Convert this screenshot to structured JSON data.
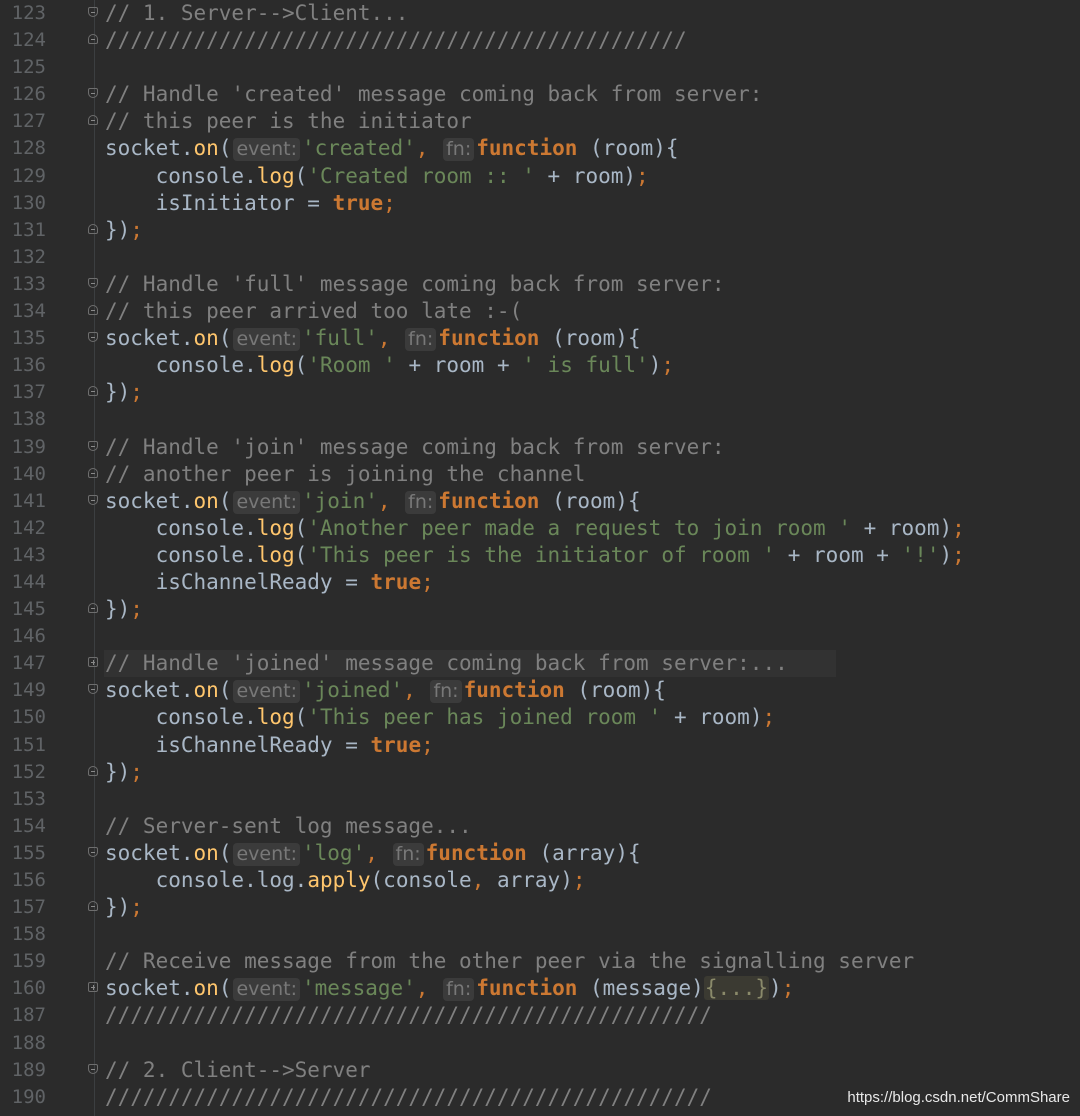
{
  "editor": {
    "lines": [
      {
        "num": "123",
        "fold": "start",
        "segs": [
          {
            "t": "// 1. Server-->Client...",
            "c": "cm"
          }
        ]
      },
      {
        "num": "124",
        "fold": "end",
        "segs": [
          {
            "t": "//////////////////////////////////////////////",
            "c": "cm"
          }
        ]
      },
      {
        "num": "125",
        "fold": "",
        "segs": []
      },
      {
        "num": "126",
        "fold": "start",
        "segs": [
          {
            "t": "// Handle 'created' message coming back from server:",
            "c": "cm"
          }
        ]
      },
      {
        "num": "127",
        "fold": "end",
        "segs": [
          {
            "t": "// this peer is the initiator",
            "c": "cm"
          }
        ]
      },
      {
        "num": "128",
        "fold": "",
        "segs": [
          {
            "t": "socket.",
            "c": "pl"
          },
          {
            "t": "on",
            "c": "fn"
          },
          {
            "t": "(",
            "c": "pl"
          },
          {
            "t": "event:",
            "c": "hint"
          },
          {
            "t": "'created'",
            "c": "str"
          },
          {
            "t": ", ",
            "c": "pn"
          },
          {
            "t": "fn:",
            "c": "hint"
          },
          {
            "t": "function",
            "c": "kw"
          },
          {
            "t": " (room){",
            "c": "pl"
          }
        ]
      },
      {
        "num": "129",
        "fold": "",
        "segs": [
          {
            "t": "    console.",
            "c": "pl"
          },
          {
            "t": "log",
            "c": "fn"
          },
          {
            "t": "(",
            "c": "pl"
          },
          {
            "t": "'Created room :: '",
            "c": "str"
          },
          {
            "t": " + room)",
            "c": "pl"
          },
          {
            "t": ";",
            "c": "pn"
          }
        ]
      },
      {
        "num": "130",
        "fold": "",
        "segs": [
          {
            "t": "    isInitiator = ",
            "c": "pl"
          },
          {
            "t": "true",
            "c": "kw"
          },
          {
            "t": ";",
            "c": "pn"
          }
        ]
      },
      {
        "num": "131",
        "fold": "end",
        "segs": [
          {
            "t": "})",
            "c": "pl"
          },
          {
            "t": ";",
            "c": "pn"
          }
        ]
      },
      {
        "num": "132",
        "fold": "",
        "segs": []
      },
      {
        "num": "133",
        "fold": "start",
        "segs": [
          {
            "t": "// Handle 'full' message coming back from server:",
            "c": "cm"
          }
        ]
      },
      {
        "num": "134",
        "fold": "end",
        "segs": [
          {
            "t": "// this peer arrived too late :-(",
            "c": "cm"
          }
        ]
      },
      {
        "num": "135",
        "fold": "start",
        "segs": [
          {
            "t": "socket.",
            "c": "pl"
          },
          {
            "t": "on",
            "c": "fn"
          },
          {
            "t": "(",
            "c": "pl"
          },
          {
            "t": "event:",
            "c": "hint"
          },
          {
            "t": "'full'",
            "c": "str"
          },
          {
            "t": ", ",
            "c": "pn"
          },
          {
            "t": "fn:",
            "c": "hint"
          },
          {
            "t": "function",
            "c": "kw"
          },
          {
            "t": " (room){",
            "c": "pl"
          }
        ]
      },
      {
        "num": "136",
        "fold": "",
        "segs": [
          {
            "t": "    console.",
            "c": "pl"
          },
          {
            "t": "log",
            "c": "fn"
          },
          {
            "t": "(",
            "c": "pl"
          },
          {
            "t": "'Room '",
            "c": "str"
          },
          {
            "t": " + room + ",
            "c": "pl"
          },
          {
            "t": "' is full'",
            "c": "str"
          },
          {
            "t": ")",
            "c": "pl"
          },
          {
            "t": ";",
            "c": "pn"
          }
        ]
      },
      {
        "num": "137",
        "fold": "end",
        "segs": [
          {
            "t": "})",
            "c": "pl"
          },
          {
            "t": ";",
            "c": "pn"
          }
        ]
      },
      {
        "num": "138",
        "fold": "",
        "segs": []
      },
      {
        "num": "139",
        "fold": "start",
        "segs": [
          {
            "t": "// Handle 'join' message coming back from server:",
            "c": "cm"
          }
        ]
      },
      {
        "num": "140",
        "fold": "end",
        "segs": [
          {
            "t": "// another peer is joining the channel",
            "c": "cm"
          }
        ]
      },
      {
        "num": "141",
        "fold": "start",
        "segs": [
          {
            "t": "socket.",
            "c": "pl"
          },
          {
            "t": "on",
            "c": "fn"
          },
          {
            "t": "(",
            "c": "pl"
          },
          {
            "t": "event:",
            "c": "hint"
          },
          {
            "t": "'join'",
            "c": "str"
          },
          {
            "t": ", ",
            "c": "pn"
          },
          {
            "t": "fn:",
            "c": "hint"
          },
          {
            "t": "function",
            "c": "kw"
          },
          {
            "t": " (room){",
            "c": "pl"
          }
        ]
      },
      {
        "num": "142",
        "fold": "",
        "segs": [
          {
            "t": "    console.",
            "c": "pl"
          },
          {
            "t": "log",
            "c": "fn"
          },
          {
            "t": "(",
            "c": "pl"
          },
          {
            "t": "'Another peer made a request to join room '",
            "c": "str"
          },
          {
            "t": " + room)",
            "c": "pl"
          },
          {
            "t": ";",
            "c": "pn"
          }
        ]
      },
      {
        "num": "143",
        "fold": "",
        "segs": [
          {
            "t": "    console.",
            "c": "pl"
          },
          {
            "t": "log",
            "c": "fn"
          },
          {
            "t": "(",
            "c": "pl"
          },
          {
            "t": "'This peer is the initiator of room '",
            "c": "str"
          },
          {
            "t": " + room + ",
            "c": "pl"
          },
          {
            "t": "'!'",
            "c": "str"
          },
          {
            "t": ")",
            "c": "pl"
          },
          {
            "t": ";",
            "c": "pn"
          }
        ]
      },
      {
        "num": "144",
        "fold": "",
        "segs": [
          {
            "t": "    isChannelReady = ",
            "c": "pl"
          },
          {
            "t": "true",
            "c": "kw"
          },
          {
            "t": ";",
            "c": "pn"
          }
        ]
      },
      {
        "num": "145",
        "fold": "end",
        "segs": [
          {
            "t": "})",
            "c": "pl"
          },
          {
            "t": ";",
            "c": "pn"
          }
        ]
      },
      {
        "num": "146",
        "fold": "",
        "segs": []
      },
      {
        "num": "147",
        "fold": "plus",
        "hl": true,
        "segs": [
          {
            "t": "// Handle 'joined' message coming back from server:...",
            "c": "cm"
          }
        ]
      },
      {
        "num": "149",
        "fold": "start",
        "segs": [
          {
            "t": "socket.",
            "c": "pl"
          },
          {
            "t": "on",
            "c": "fn"
          },
          {
            "t": "(",
            "c": "pl"
          },
          {
            "t": "event:",
            "c": "hint"
          },
          {
            "t": "'joined'",
            "c": "str"
          },
          {
            "t": ", ",
            "c": "pn"
          },
          {
            "t": "fn:",
            "c": "hint"
          },
          {
            "t": "function",
            "c": "kw"
          },
          {
            "t": " (room){",
            "c": "pl"
          }
        ]
      },
      {
        "num": "150",
        "fold": "",
        "segs": [
          {
            "t": "    console.",
            "c": "pl"
          },
          {
            "t": "log",
            "c": "fn"
          },
          {
            "t": "(",
            "c": "pl"
          },
          {
            "t": "'This peer has joined room '",
            "c": "str"
          },
          {
            "t": " + room)",
            "c": "pl"
          },
          {
            "t": ";",
            "c": "pn"
          }
        ]
      },
      {
        "num": "151",
        "fold": "",
        "segs": [
          {
            "t": "    isChannelReady = ",
            "c": "pl"
          },
          {
            "t": "true",
            "c": "kw"
          },
          {
            "t": ";",
            "c": "pn"
          }
        ]
      },
      {
        "num": "152",
        "fold": "end",
        "segs": [
          {
            "t": "})",
            "c": "pl"
          },
          {
            "t": ";",
            "c": "pn"
          }
        ]
      },
      {
        "num": "153",
        "fold": "",
        "segs": []
      },
      {
        "num": "154",
        "fold": "",
        "segs": [
          {
            "t": "// Server-sent log message...",
            "c": "cm"
          }
        ]
      },
      {
        "num": "155",
        "fold": "start",
        "segs": [
          {
            "t": "socket.",
            "c": "pl"
          },
          {
            "t": "on",
            "c": "fn"
          },
          {
            "t": "(",
            "c": "pl"
          },
          {
            "t": "event:",
            "c": "hint"
          },
          {
            "t": "'log'",
            "c": "str"
          },
          {
            "t": ", ",
            "c": "pn"
          },
          {
            "t": "fn:",
            "c": "hint"
          },
          {
            "t": "function",
            "c": "kw"
          },
          {
            "t": " (array){",
            "c": "pl"
          }
        ]
      },
      {
        "num": "156",
        "fold": "",
        "segs": [
          {
            "t": "    console.",
            "c": "pl"
          },
          {
            "t": "log",
            "c": "pl"
          },
          {
            "t": ".",
            "c": "pl"
          },
          {
            "t": "apply",
            "c": "fn"
          },
          {
            "t": "(console",
            "c": "pl"
          },
          {
            "t": ", ",
            "c": "pn"
          },
          {
            "t": "array)",
            "c": "pl"
          },
          {
            "t": ";",
            "c": "pn"
          }
        ]
      },
      {
        "num": "157",
        "fold": "end",
        "segs": [
          {
            "t": "})",
            "c": "pl"
          },
          {
            "t": ";",
            "c": "pn"
          }
        ]
      },
      {
        "num": "158",
        "fold": "",
        "segs": []
      },
      {
        "num": "159",
        "fold": "",
        "segs": [
          {
            "t": "// Receive message from the other peer via the signalling server",
            "c": "cm"
          }
        ]
      },
      {
        "num": "160",
        "fold": "plus",
        "segs": [
          {
            "t": "socket.",
            "c": "pl"
          },
          {
            "t": "on",
            "c": "fn"
          },
          {
            "t": "(",
            "c": "pl"
          },
          {
            "t": "event:",
            "c": "hint"
          },
          {
            "t": "'message'",
            "c": "str"
          },
          {
            "t": ", ",
            "c": "pn"
          },
          {
            "t": "fn:",
            "c": "hint"
          },
          {
            "t": "function",
            "c": "kw"
          },
          {
            "t": " (message)",
            "c": "pl"
          },
          {
            "t": "{...}",
            "c": "folded"
          },
          {
            "t": ")",
            "c": "pl"
          },
          {
            "t": ";",
            "c": "pn"
          }
        ]
      },
      {
        "num": "187",
        "fold": "",
        "segs": [
          {
            "t": "////////////////////////////////////////////////",
            "c": "cm"
          }
        ]
      },
      {
        "num": "188",
        "fold": "",
        "segs": []
      },
      {
        "num": "189",
        "fold": "start",
        "segs": [
          {
            "t": "// 2. Client-->Server",
            "c": "cm"
          }
        ]
      },
      {
        "num": "190",
        "fold": "",
        "segs": [
          {
            "t": "////////////////////////////////////////////////",
            "c": "cm"
          }
        ]
      }
    ]
  },
  "watermark": "https://blog.csdn.net/CommShare",
  "colors": {
    "background": "#2b2b2b",
    "comment": "#808080",
    "keyword": "#cc7832",
    "string": "#6a8759",
    "function": "#ffc66d",
    "plain": "#a9b7c6"
  }
}
